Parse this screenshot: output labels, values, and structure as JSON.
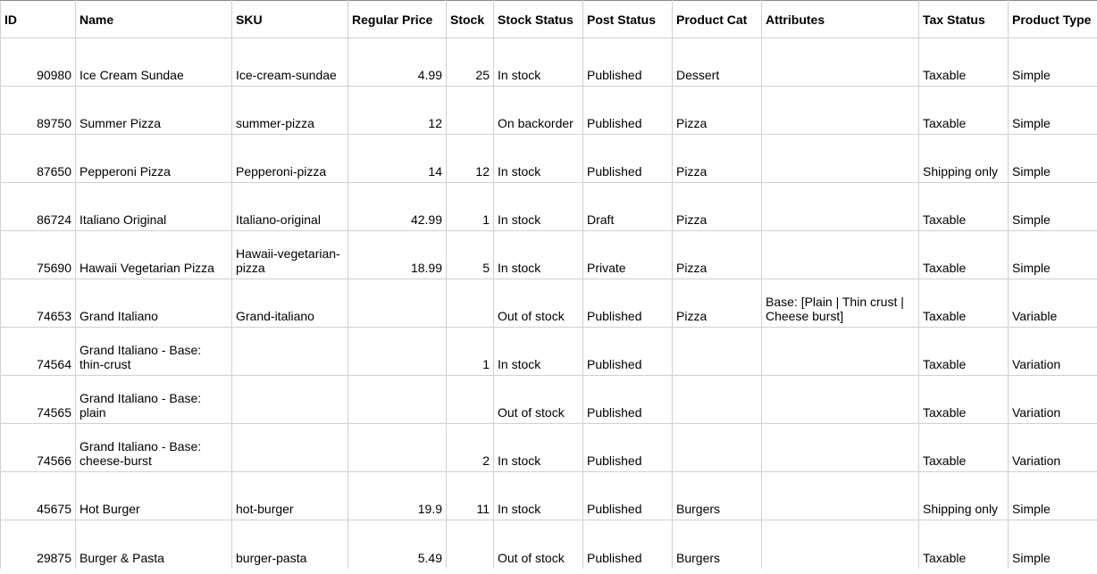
{
  "headers": {
    "id": "ID",
    "name": "Name",
    "sku": "SKU",
    "price": "Regular Price",
    "stock": "Stock",
    "stockstatus": "Stock Status",
    "poststatus": "Post Status",
    "cat": "Product Cat",
    "attr": "Attributes",
    "tax": "Tax Status",
    "type": "Product Type"
  },
  "rows": [
    {
      "id": "90980",
      "name": "Ice Cream Sundae",
      "sku": "Ice-cream-sundae",
      "price": "4.99",
      "stock": "25",
      "stockstatus": "In stock",
      "poststatus": "Published",
      "cat": "Dessert",
      "attr": "",
      "tax": "Taxable",
      "type": "Simple"
    },
    {
      "id": "89750",
      "name": "Summer Pizza",
      "sku": "summer-pizza",
      "price": "12",
      "stock": "",
      "stockstatus": "On backorder",
      "poststatus": "Published",
      "cat": "Pizza",
      "attr": "",
      "tax": "Taxable",
      "type": "Simple"
    },
    {
      "id": "87650",
      "name": "Pepperoni Pizza",
      "sku": "Pepperoni-pizza",
      "price": "14",
      "stock": "12",
      "stockstatus": "In stock",
      "poststatus": "Published",
      "cat": "Pizza",
      "attr": "",
      "tax": "Shipping only",
      "type": "Simple"
    },
    {
      "id": "86724",
      "name": "Italiano Original",
      "sku": "Italiano-original",
      "price": "42.99",
      "stock": "1",
      "stockstatus": "In stock",
      "poststatus": "Draft",
      "cat": "Pizza",
      "attr": "",
      "tax": "Taxable",
      "type": "Simple"
    },
    {
      "id": "75690",
      "name": "Hawaii Vegetarian Pizza",
      "sku": "Hawaii-vegetarian-pizza",
      "price": "18.99",
      "stock": "5",
      "stockstatus": "In stock",
      "poststatus": "Private",
      "cat": "Pizza",
      "attr": "",
      "tax": "Taxable",
      "type": "Simple"
    },
    {
      "id": "74653",
      "name": "Grand Italiano",
      "sku": "Grand-italiano",
      "price": "",
      "stock": "",
      "stockstatus": "Out of stock",
      "poststatus": "Published",
      "cat": "Pizza",
      "attr": "Base: [Plain | Thin crust | Cheese burst]",
      "tax": "Taxable",
      "type": "Variable"
    },
    {
      "id": "74564",
      "name": "Grand Italiano - Base: thin-crust",
      "sku": "",
      "price": "",
      "stock": "1",
      "stockstatus": "In stock",
      "poststatus": "Published",
      "cat": "",
      "attr": "",
      "tax": "Taxable",
      "type": "Variation"
    },
    {
      "id": "74565",
      "name": "Grand Italiano - Base: plain",
      "sku": "",
      "price": "",
      "stock": "",
      "stockstatus": "Out of stock",
      "poststatus": "Published",
      "cat": "",
      "attr": "",
      "tax": "Taxable",
      "type": "Variation"
    },
    {
      "id": "74566",
      "name": "Grand Italiano - Base: cheese-burst",
      "sku": "",
      "price": "",
      "stock": "2",
      "stockstatus": "In stock",
      "poststatus": "Published",
      "cat": "",
      "attr": "",
      "tax": "Taxable",
      "type": "Variation"
    },
    {
      "id": "45675",
      "name": "Hot Burger",
      "sku": "hot-burger",
      "price": "19.9",
      "stock": "11",
      "stockstatus": "In stock",
      "poststatus": "Published",
      "cat": "Burgers",
      "attr": "",
      "tax": "Shipping only",
      "type": "Simple"
    },
    {
      "id": "29875",
      "name": "Burger & Pasta",
      "sku": "burger-pasta",
      "price": "5.49",
      "stock": "",
      "stockstatus": "Out of stock",
      "poststatus": "Published",
      "cat": "Burgers",
      "attr": "",
      "tax": "Taxable",
      "type": "Simple"
    }
  ]
}
